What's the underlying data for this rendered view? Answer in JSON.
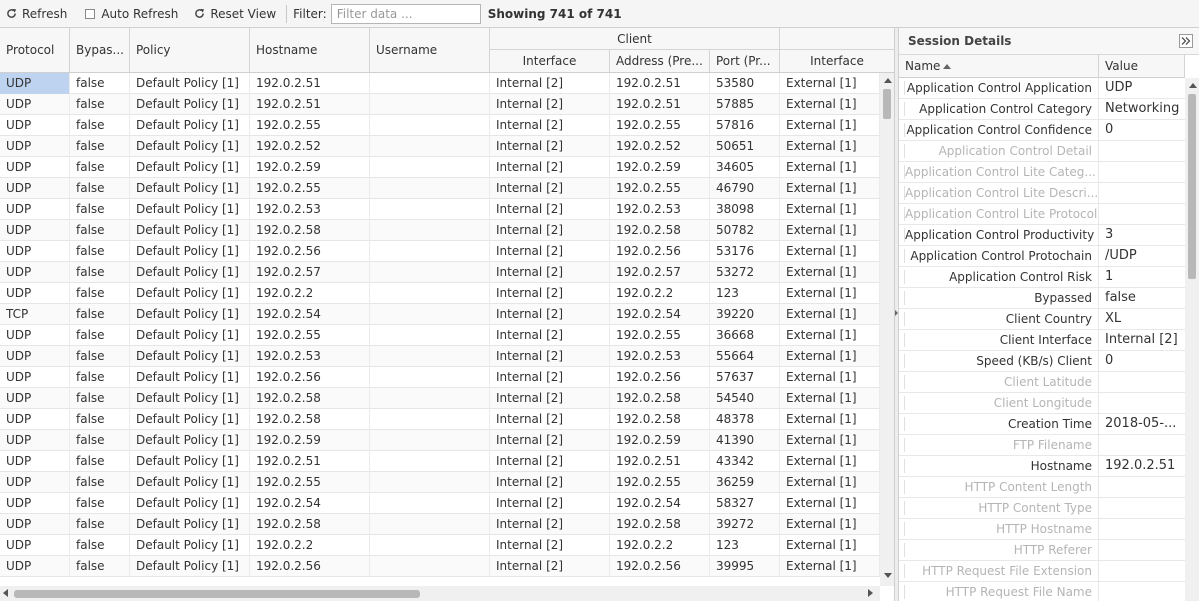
{
  "toolbar": {
    "refresh_label": "Refresh",
    "auto_refresh_label": "Auto Refresh",
    "reset_view_label": "Reset View",
    "filter_label": "Filter:",
    "filter_placeholder": "Filter data ...",
    "showing_text": "Showing 741 of 741"
  },
  "grid": {
    "group_headers": {
      "client": "Client"
    },
    "columns": {
      "protocol": "Protocol",
      "bypassed": "Bypas...",
      "policy": "Policy",
      "hostname": "Hostname",
      "username": "Username",
      "client_interface": "Interface",
      "client_address": "Address (Pre...",
      "client_port": "Port (Pr...",
      "server_interface": "Interface"
    },
    "rows": [
      [
        "UDP",
        "false",
        "Default Policy [1]",
        "192.0.2.51",
        "",
        "Internal [2]",
        "192.0.2.51",
        "53580",
        "External [1]"
      ],
      [
        "UDP",
        "false",
        "Default Policy [1]",
        "192.0.2.51",
        "",
        "Internal [2]",
        "192.0.2.51",
        "57885",
        "External [1]"
      ],
      [
        "UDP",
        "false",
        "Default Policy [1]",
        "192.0.2.55",
        "",
        "Internal [2]",
        "192.0.2.55",
        "57816",
        "External [1]"
      ],
      [
        "UDP",
        "false",
        "Default Policy [1]",
        "192.0.2.52",
        "",
        "Internal [2]",
        "192.0.2.52",
        "50651",
        "External [1]"
      ],
      [
        "UDP",
        "false",
        "Default Policy [1]",
        "192.0.2.59",
        "",
        "Internal [2]",
        "192.0.2.59",
        "34605",
        "External [1]"
      ],
      [
        "UDP",
        "false",
        "Default Policy [1]",
        "192.0.2.55",
        "",
        "Internal [2]",
        "192.0.2.55",
        "46790",
        "External [1]"
      ],
      [
        "UDP",
        "false",
        "Default Policy [1]",
        "192.0.2.53",
        "",
        "Internal [2]",
        "192.0.2.53",
        "38098",
        "External [1]"
      ],
      [
        "UDP",
        "false",
        "Default Policy [1]",
        "192.0.2.58",
        "",
        "Internal [2]",
        "192.0.2.58",
        "50782",
        "External [1]"
      ],
      [
        "UDP",
        "false",
        "Default Policy [1]",
        "192.0.2.56",
        "",
        "Internal [2]",
        "192.0.2.56",
        "53176",
        "External [1]"
      ],
      [
        "UDP",
        "false",
        "Default Policy [1]",
        "192.0.2.57",
        "",
        "Internal [2]",
        "192.0.2.57",
        "53272",
        "External [1]"
      ],
      [
        "UDP",
        "false",
        "Default Policy [1]",
        "192.0.2.2",
        "",
        "Internal [2]",
        "192.0.2.2",
        "123",
        "External [1]"
      ],
      [
        "TCP",
        "false",
        "Default Policy [1]",
        "192.0.2.54",
        "",
        "Internal [2]",
        "192.0.2.54",
        "39220",
        "External [1]"
      ],
      [
        "UDP",
        "false",
        "Default Policy [1]",
        "192.0.2.55",
        "",
        "Internal [2]",
        "192.0.2.55",
        "36668",
        "External [1]"
      ],
      [
        "UDP",
        "false",
        "Default Policy [1]",
        "192.0.2.53",
        "",
        "Internal [2]",
        "192.0.2.53",
        "55664",
        "External [1]"
      ],
      [
        "UDP",
        "false",
        "Default Policy [1]",
        "192.0.2.56",
        "",
        "Internal [2]",
        "192.0.2.56",
        "57637",
        "External [1]"
      ],
      [
        "UDP",
        "false",
        "Default Policy [1]",
        "192.0.2.58",
        "",
        "Internal [2]",
        "192.0.2.58",
        "54540",
        "External [1]"
      ],
      [
        "UDP",
        "false",
        "Default Policy [1]",
        "192.0.2.58",
        "",
        "Internal [2]",
        "192.0.2.58",
        "48378",
        "External [1]"
      ],
      [
        "UDP",
        "false",
        "Default Policy [1]",
        "192.0.2.59",
        "",
        "Internal [2]",
        "192.0.2.59",
        "41390",
        "External [1]"
      ],
      [
        "UDP",
        "false",
        "Default Policy [1]",
        "192.0.2.51",
        "",
        "Internal [2]",
        "192.0.2.51",
        "43342",
        "External [1]"
      ],
      [
        "UDP",
        "false",
        "Default Policy [1]",
        "192.0.2.55",
        "",
        "Internal [2]",
        "192.0.2.55",
        "36259",
        "External [1]"
      ],
      [
        "UDP",
        "false",
        "Default Policy [1]",
        "192.0.2.54",
        "",
        "Internal [2]",
        "192.0.2.54",
        "58327",
        "External [1]"
      ],
      [
        "UDP",
        "false",
        "Default Policy [1]",
        "192.0.2.58",
        "",
        "Internal [2]",
        "192.0.2.58",
        "39272",
        "External [1]"
      ],
      [
        "UDP",
        "false",
        "Default Policy [1]",
        "192.0.2.2",
        "",
        "Internal [2]",
        "192.0.2.2",
        "123",
        "External [1]"
      ],
      [
        "UDP",
        "false",
        "Default Policy [1]",
        "192.0.2.56",
        "",
        "Internal [2]",
        "192.0.2.56",
        "39995",
        "External [1]"
      ]
    ]
  },
  "details": {
    "title": "Session Details",
    "col_name": "Name",
    "col_value": "Value",
    "rows": [
      {
        "name": "Application Control Application",
        "value": "UDP",
        "disabled": false
      },
      {
        "name": "Application Control Category",
        "value": "Networking",
        "disabled": false
      },
      {
        "name": "Application Control Confidence",
        "value": "0",
        "disabled": false
      },
      {
        "name": "Application Control Detail",
        "value": "",
        "disabled": true
      },
      {
        "name": "Application Control Lite Categ...",
        "value": "",
        "disabled": true
      },
      {
        "name": "Application Control Lite Descri...",
        "value": "",
        "disabled": true
      },
      {
        "name": "Application Control Lite Protocol",
        "value": "",
        "disabled": true
      },
      {
        "name": "Application Control Productivity",
        "value": "3",
        "disabled": false
      },
      {
        "name": "Application Control Protochain",
        "value": "/UDP",
        "disabled": false
      },
      {
        "name": "Application Control Risk",
        "value": "1",
        "disabled": false
      },
      {
        "name": "Bypassed",
        "value": "false",
        "disabled": false
      },
      {
        "name": "Client Country",
        "value": "XL",
        "disabled": false
      },
      {
        "name": "Client Interface",
        "value": "Internal [2]",
        "disabled": false
      },
      {
        "name": "Speed (KB/s) Client",
        "value": "0",
        "disabled": false
      },
      {
        "name": "Client Latitude",
        "value": "",
        "disabled": true
      },
      {
        "name": "Client Longitude",
        "value": "",
        "disabled": true
      },
      {
        "name": "Creation Time",
        "value": "2018-05-...",
        "disabled": false
      },
      {
        "name": "FTP Filename",
        "value": "",
        "disabled": true
      },
      {
        "name": "Hostname",
        "value": "192.0.2.51",
        "disabled": false
      },
      {
        "name": "HTTP Content Length",
        "value": "",
        "disabled": true
      },
      {
        "name": "HTTP Content Type",
        "value": "",
        "disabled": true
      },
      {
        "name": "HTTP Hostname",
        "value": "",
        "disabled": true
      },
      {
        "name": "HTTP Referer",
        "value": "",
        "disabled": true
      },
      {
        "name": "HTTP Request File Extension",
        "value": "",
        "disabled": true
      },
      {
        "name": "HTTP Request File Name",
        "value": "",
        "disabled": true
      }
    ]
  },
  "colors": {
    "selected_cell": "#bdd3ef",
    "disabled_text": "#b5b5b5"
  }
}
